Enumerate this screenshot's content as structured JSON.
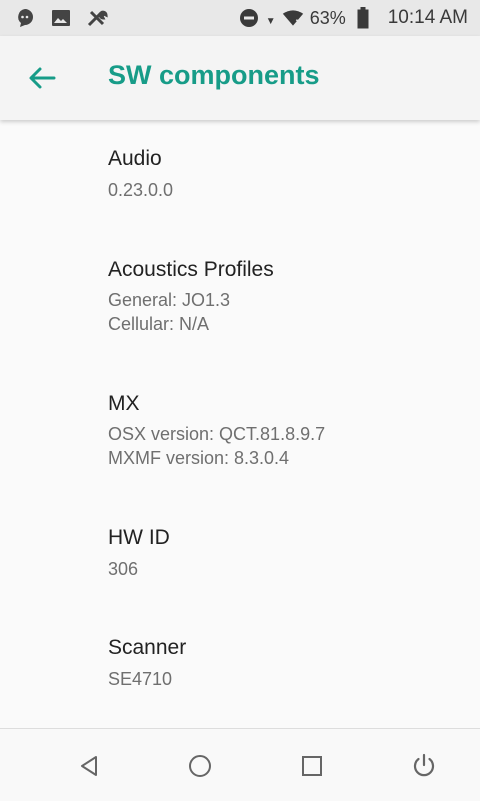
{
  "status_bar": {
    "left_icons": [
      "chat-bubble-icon",
      "image-icon",
      "tools-icon"
    ],
    "battery_percent": "63%",
    "time": "10:14 AM"
  },
  "toolbar": {
    "back_icon": "arrow-left-icon",
    "title": "SW components"
  },
  "items": [
    {
      "title": "Audio",
      "lines": [
        "0.23.0.0"
      ]
    },
    {
      "title": "Acoustics Profiles",
      "lines": [
        "General: JO1.3",
        "Cellular: N/A"
      ]
    },
    {
      "title": "MX",
      "lines": [
        "OSX version: QCT.81.8.9.7",
        "MXMF version: 8.3.0.4"
      ]
    },
    {
      "title": "HW ID",
      "lines": [
        "306"
      ]
    },
    {
      "title": "Scanner",
      "lines": [
        "SE4710"
      ]
    }
  ],
  "navbar": {
    "buttons": [
      "back-triangle-icon",
      "home-circle-icon",
      "recents-square-icon",
      "power-icon"
    ]
  },
  "colors": {
    "accent": "#179c88",
    "status_bar_bg": "#e8e8e8",
    "toolbar_bg": "#f4f4f4"
  }
}
